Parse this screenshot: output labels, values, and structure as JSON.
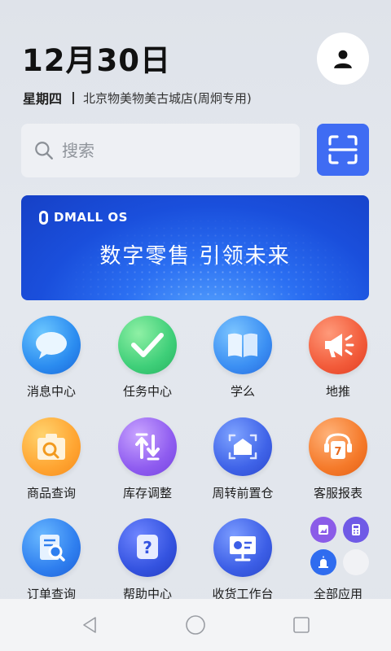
{
  "header": {
    "date": "12月30日",
    "weekday": "星期四",
    "store": "北京物美物美古城店(周炯专用)"
  },
  "avatar": {
    "icon": "person-icon"
  },
  "search": {
    "placeholder": "搜索",
    "value": ""
  },
  "scan": {
    "icon": "scan-icon",
    "color": "#3f6cf3"
  },
  "banner": {
    "logo_text": "DMALL OS",
    "slogan": "数字零售  引领未来"
  },
  "apps": [
    {
      "label": "消息中心",
      "icon": "message-bubble-icon"
    },
    {
      "label": "任务中心",
      "icon": "checkmark-icon"
    },
    {
      "label": "学么",
      "icon": "book-icon"
    },
    {
      "label": "地推",
      "icon": "megaphone-icon"
    },
    {
      "label": "商品查询",
      "icon": "product-search-icon"
    },
    {
      "label": "库存调整",
      "icon": "inventory-arrows-icon"
    },
    {
      "label": "周转前置仓",
      "icon": "warehouse-icon"
    },
    {
      "label": "客服报表",
      "icon": "calendar-report-icon"
    },
    {
      "label": "订单查询",
      "icon": "order-search-icon"
    },
    {
      "label": "帮助中心",
      "icon": "help-icon"
    },
    {
      "label": "收货工作台",
      "icon": "presentation-board-icon"
    },
    {
      "label": "全部应用",
      "icon": "all-apps-icon"
    }
  ],
  "navbar": {
    "back": "back-triangle-icon",
    "home": "home-circle-icon",
    "recent": "recent-square-icon"
  }
}
